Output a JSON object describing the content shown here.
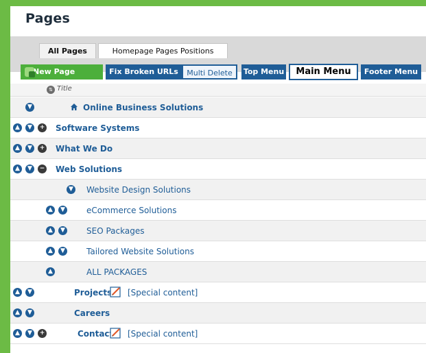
{
  "page": {
    "title": "Pages"
  },
  "tabs": [
    {
      "label": "All Pages"
    },
    {
      "label": "Homepage Pages Positions"
    }
  ],
  "toolbar": {
    "new_page": "New Page",
    "fix_broken_urls": "Fix Broken URLs",
    "multi_delete": "Multi Delete",
    "top_menu": "Top Menu",
    "main_menu": "Main Menu",
    "footer_menu": "Footer Menu"
  },
  "column": {
    "title": "Title"
  },
  "rows": [
    {
      "label": "Online Business Solutions",
      "bold": true
    },
    {
      "label": "Software Systems",
      "bold": true
    },
    {
      "label": "What We Do",
      "bold": true
    },
    {
      "label": "Web Solutions",
      "bold": true
    },
    {
      "label": "Website Design Solutions",
      "bold": false
    },
    {
      "label": "eCommerce Solutions",
      "bold": false
    },
    {
      "label": "SEO Packages",
      "bold": false
    },
    {
      "label": "Tailored Website Solutions",
      "bold": false
    },
    {
      "label": "ALL PACKAGES",
      "bold": false
    },
    {
      "label": "Projects",
      "bold": true,
      "special": "[Special content]"
    },
    {
      "label": "Careers",
      "bold": true
    },
    {
      "label": "Contact",
      "bold": true,
      "special": "[Special content]"
    }
  ],
  "colors": {
    "accent": "#1f5d97",
    "frame": "#6cbb45",
    "new_button": "#4caf3b"
  }
}
